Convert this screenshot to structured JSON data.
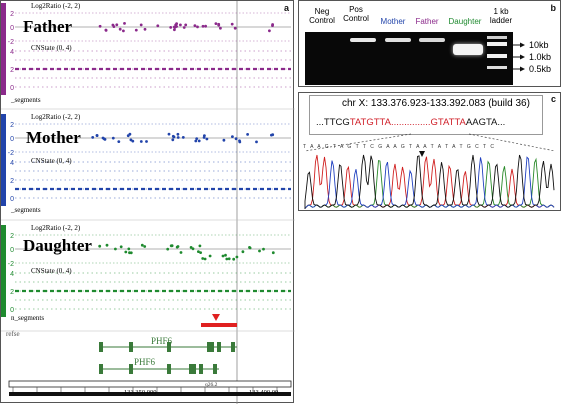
{
  "panel_labels": {
    "a": "a",
    "b": "b",
    "c": "c"
  },
  "panel_a": {
    "tracks": [
      {
        "name": "Father",
        "color": "#8b2a8b",
        "ratio_label": "Log2Ratio (-2, 2)",
        "cn_label": "CNState (0, 4)",
        "segments_label": "_segments",
        "ticks": [
          "2",
          "0",
          "-2",
          "4",
          "2",
          "0"
        ]
      },
      {
        "name": "Mother",
        "color": "#2244aa",
        "ratio_label": "Log2Ratio (-2, 2)",
        "cn_label": "CNState (0, 4)",
        "segments_label": "_segments",
        "ticks": [
          "2",
          "0",
          "-2",
          "4",
          "2",
          "0"
        ]
      },
      {
        "name": "Daughter",
        "color": "#1f8a2f",
        "ratio_label": "Log2Ratio (-2, 2)",
        "cn_label": "CNState (0, 4)",
        "segments_label": "n_segments",
        "ticks": [
          "2",
          "0",
          "-2",
          "4",
          "2",
          "0"
        ]
      }
    ],
    "gene_track_label": "refse",
    "gene_names": [
      "PHF6",
      "PHF6"
    ],
    "axis_labels": [
      "133 350 000",
      "133 400 00"
    ],
    "band_label": "q26.2",
    "deletion_color": "#e02020"
  },
  "panel_b": {
    "lanes": [
      {
        "label": "Neg\nControl",
        "color": "#111111"
      },
      {
        "label": "Pos\nControl",
        "color": "#111111"
      },
      {
        "label": "Mother",
        "color": "#2244aa"
      },
      {
        "label": "Father",
        "color": "#8b2a8b"
      },
      {
        "label": "Daughter",
        "color": "#1f8a2f"
      },
      {
        "label": "1 kb\nladder",
        "color": "#111111"
      }
    ],
    "size_markers": [
      "10kb",
      "1.0kb",
      "0.5kb"
    ]
  },
  "panel_c": {
    "coordinate": "chr X: 133.376.923-133.392.083 (build 36)",
    "seq_parts": [
      {
        "text": "...TTCG",
        "color": "#111111"
      },
      {
        "text": "TATGTTA...............GTATTA",
        "color": "#d0202a"
      },
      {
        "text": "AAGTA...",
        "color": "#111111"
      }
    ],
    "base_calls": "T A A G  T A G  T  T  C  G A A G  T A A  T A  T A  T G C T  C"
  }
}
